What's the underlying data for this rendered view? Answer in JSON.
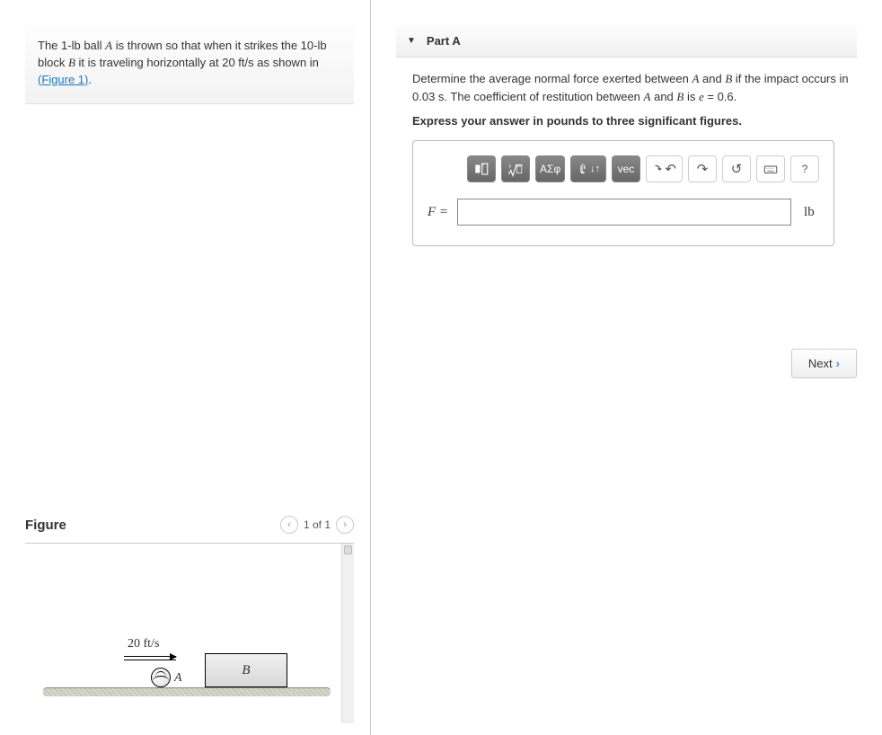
{
  "problem": {
    "prefix": "The 1-",
    "unit1": "lb",
    "mid1": " ball ",
    "varA": "A",
    "mid2": " is thrown so that when it strikes the 10-",
    "unit2": "lb",
    "mid3": " block ",
    "varB": "B",
    "mid4": " it is traveling horizontally at 20 ",
    "speed_unit": "ft/s",
    "mid5": " as shown in ",
    "figlink": "(Figure 1)",
    "period": "."
  },
  "figure": {
    "title": "Figure",
    "pager": "1 of 1",
    "speed": "20 ft/s",
    "labelA": "A",
    "labelB": "B"
  },
  "part": {
    "title": "Part A",
    "line1a": "Determine the average normal force exerted between ",
    "A": "A",
    "line1b": " and ",
    "B": "B",
    "line1c": " if the impact occurs in 0.03 ",
    "s": "s",
    "line1d": ". The coefficient of restitution between ",
    "line1e": " is ",
    "e": "e",
    "line1f": " = 0.6.",
    "express": "Express your answer in pounds to three significant figures.",
    "eq_label": "F =",
    "unit": "lb",
    "toolbar": {
      "greek": "ΑΣφ",
      "vec": "vec",
      "help": "?"
    }
  },
  "buttons": {
    "next": "Next"
  }
}
